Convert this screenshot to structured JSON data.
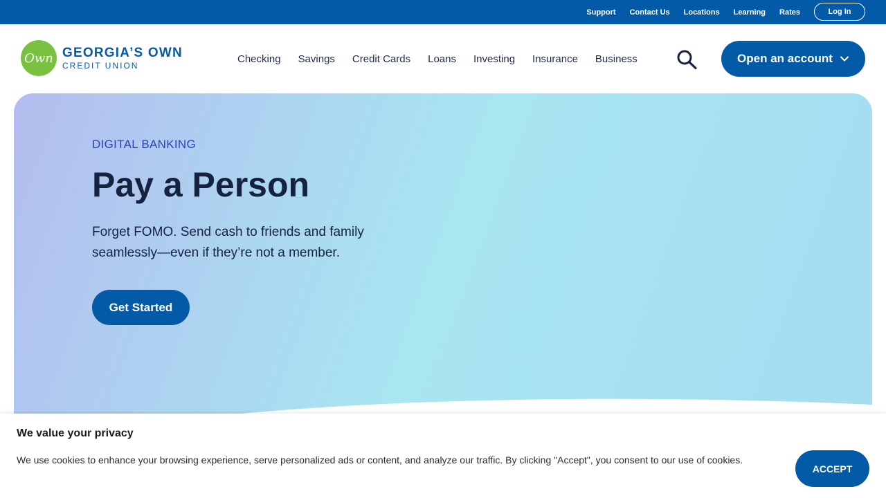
{
  "utility_nav": {
    "links": [
      "Support",
      "Contact Us",
      "Locations",
      "Learning",
      "Rates"
    ],
    "login_label": "Log In"
  },
  "brand": {
    "logo_mark": "Own",
    "name_line1": "GEORGIA’S OWN",
    "name_line2": "CREDIT UNION"
  },
  "main_nav": {
    "items": [
      "Checking",
      "Savings",
      "Credit Cards",
      "Loans",
      "Investing",
      "Insurance",
      "Business"
    ],
    "search_icon": "search-icon",
    "open_account_label": "Open an account"
  },
  "hero": {
    "eyebrow": "DIGITAL BANKING",
    "title": "Pay a Person",
    "subtitle": "Forget FOMO. Send cash to friends and family seamlessly—even if they’re not a member.",
    "cta_label": "Get Started"
  },
  "cookie_banner": {
    "title": "We value your privacy",
    "text": "We use cookies to enhance your browsing experience, serve personalized ads or content, and analyze our traffic. By clicking \"Accept\", you consent to our use of cookies.",
    "accept_label": "ACCEPT"
  },
  "colors": {
    "brand_blue": "#035ba7",
    "logo_green": "#7ac142",
    "eyebrow_blue": "#2b45b8",
    "heading_navy": "#15233f"
  }
}
